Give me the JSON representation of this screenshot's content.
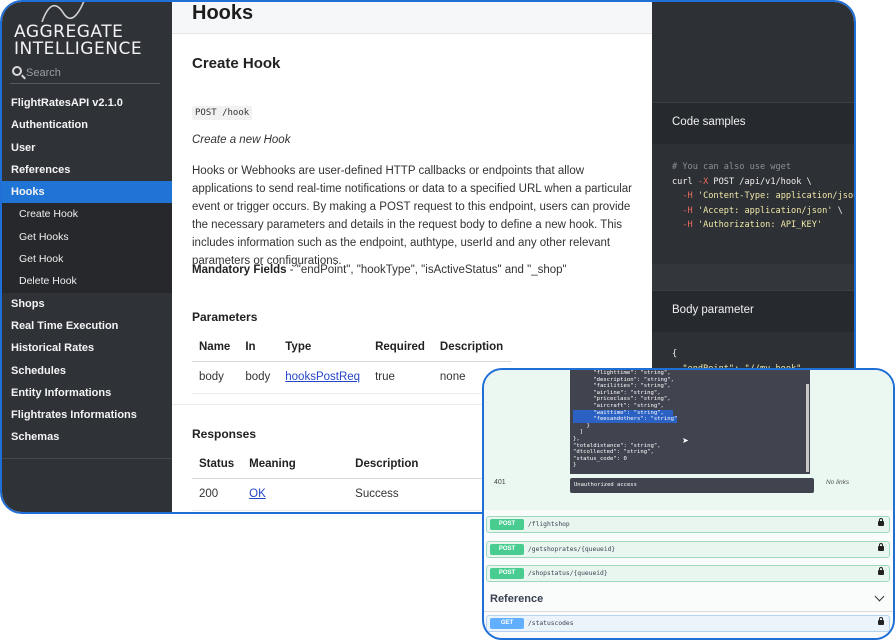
{
  "brand": {
    "line1": "AGGREGATE",
    "line2": "INTELLIGENCE"
  },
  "search": {
    "placeholder": "Search"
  },
  "nav": {
    "items": [
      "FlightRatesAPI v2.1.0",
      "Authentication",
      "User",
      "References",
      "Hooks"
    ],
    "sub": [
      "Create Hook",
      "Get Hooks",
      "Get Hook",
      "Delete Hook"
    ],
    "rest": [
      "Shops",
      "Real Time Execution",
      "Historical Rates",
      "Schedules",
      "Entity Informations",
      "Flightrates Informations",
      "Schemas"
    ]
  },
  "content": {
    "page_title": "Hooks",
    "heading": "Create Hook",
    "endpoint": "POST /hook",
    "summary": "Create a new Hook",
    "description": "Hooks or Webhooks are user-defined HTTP callbacks or endpoints that allow applications to send real-time notifications or data to a specified URL when a particular event or trigger occurs. By making a POST request to this endpoint, users can provide the necessary parameters and details in the request body to define a new hook. This includes information such as the endpoint, authtype, userId and any other relevant parameters or configurations.",
    "mandatory_label": "Mandatory Fields",
    "mandatory_text": " - \"endPoint\", \"hookType\", \"isActiveStatus\" and \"_shop\"",
    "parameters_title": "Parameters",
    "param_headers": [
      "Name",
      "In",
      "Type",
      "Required",
      "Description"
    ],
    "param_row": [
      "body",
      "body",
      "hooksPostReq",
      "true",
      "none"
    ],
    "responses_title": "Responses",
    "resp_headers": [
      "Status",
      "Meaning",
      "Description"
    ],
    "resp_row": [
      "200",
      "OK",
      "Success"
    ]
  },
  "code": {
    "samples_title": "Code samples",
    "comment": "# You can also use wget",
    "curl": "curl",
    "flag_x": "-X",
    "cmd": " POST /api/v1/hook \\",
    "flag_h": "-H",
    "h1": "'Content-Type: application/json'",
    "h2": "'Accept: application/json'",
    "h3": "'Authorization: API_KEY'",
    "h2_tail": " \\",
    "body_title": "Body parameter",
    "body_brace": "{",
    "body_line": "\"endPoint\": \"//my-hook\","
  },
  "overlay": {
    "code_lines": [
      "      \"flighttime\": \"string\",",
      "      \"description\": \"string\",",
      "      \"facilities\": \"string\",",
      "      \"airline\": \"string\",",
      "      \"priceclass\": \"string\",",
      "      \"aircraft\": \"string\",",
      "      \"waittime\": \"string\",",
      "      \"feesandothers\": \"string\"",
      "    }",
      "  ]",
      "},",
      "\"totaldistance\": \"string\",",
      "\"dtcollected\": \"string\",",
      "\"status_code\": 0",
      "}"
    ],
    "status_401": "401",
    "unauthorized": "Unauthorized access",
    "no_links": "No links",
    "ops": [
      {
        "verb": "POST",
        "path": "/flightshop"
      },
      {
        "verb": "POST",
        "path": "/getshoprates/{queueid}"
      },
      {
        "verb": "POST",
        "path": "/shopstatus/{queueid}"
      }
    ],
    "reference_title": "Reference",
    "get_op": {
      "verb": "GET",
      "path": "/statuscodes"
    }
  }
}
